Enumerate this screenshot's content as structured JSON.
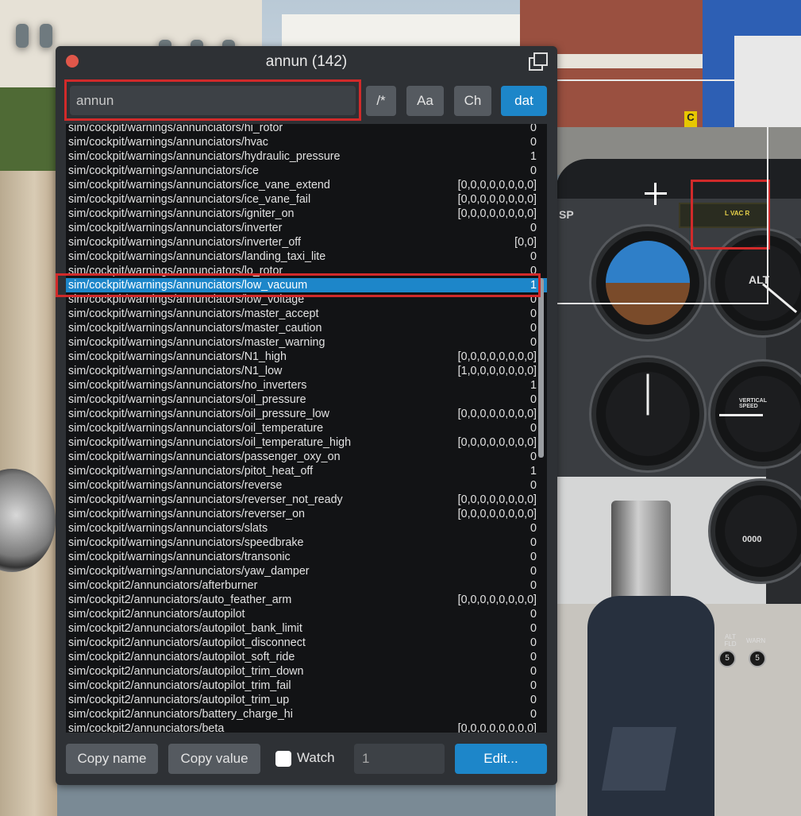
{
  "window": {
    "title": "annun (142)"
  },
  "search": {
    "value": "annun"
  },
  "toolbar": {
    "regex_label": "/*",
    "case_label": "Aa",
    "changes_label": "Ch",
    "dat_label": "dat"
  },
  "datarefs": [
    {
      "name": "sim/cockpit/warnings/annunciators/hi_rotor",
      "value": "0"
    },
    {
      "name": "sim/cockpit/warnings/annunciators/hvac",
      "value": "0"
    },
    {
      "name": "sim/cockpit/warnings/annunciators/hydraulic_pressure",
      "value": "1"
    },
    {
      "name": "sim/cockpit/warnings/annunciators/ice",
      "value": "0"
    },
    {
      "name": "sim/cockpit/warnings/annunciators/ice_vane_extend",
      "value": "[0,0,0,0,0,0,0,0]"
    },
    {
      "name": "sim/cockpit/warnings/annunciators/ice_vane_fail",
      "value": "[0,0,0,0,0,0,0,0]"
    },
    {
      "name": "sim/cockpit/warnings/annunciators/igniter_on",
      "value": "[0,0,0,0,0,0,0,0]"
    },
    {
      "name": "sim/cockpit/warnings/annunciators/inverter",
      "value": "0"
    },
    {
      "name": "sim/cockpit/warnings/annunciators/inverter_off",
      "value": "[0,0]"
    },
    {
      "name": "sim/cockpit/warnings/annunciators/landing_taxi_lite",
      "value": "0"
    },
    {
      "name": "sim/cockpit/warnings/annunciators/lo_rotor",
      "value": "0"
    },
    {
      "name": "sim/cockpit/warnings/annunciators/low_vacuum",
      "value": "1"
    },
    {
      "name": "sim/cockpit/warnings/annunciators/low_voltage",
      "value": "0"
    },
    {
      "name": "sim/cockpit/warnings/annunciators/master_accept",
      "value": "0"
    },
    {
      "name": "sim/cockpit/warnings/annunciators/master_caution",
      "value": "0"
    },
    {
      "name": "sim/cockpit/warnings/annunciators/master_warning",
      "value": "0"
    },
    {
      "name": "sim/cockpit/warnings/annunciators/N1_high",
      "value": "[0,0,0,0,0,0,0,0]"
    },
    {
      "name": "sim/cockpit/warnings/annunciators/N1_low",
      "value": "[1,0,0,0,0,0,0,0]"
    },
    {
      "name": "sim/cockpit/warnings/annunciators/no_inverters",
      "value": "1"
    },
    {
      "name": "sim/cockpit/warnings/annunciators/oil_pressure",
      "value": "0"
    },
    {
      "name": "sim/cockpit/warnings/annunciators/oil_pressure_low",
      "value": "[0,0,0,0,0,0,0,0]"
    },
    {
      "name": "sim/cockpit/warnings/annunciators/oil_temperature",
      "value": "0"
    },
    {
      "name": "sim/cockpit/warnings/annunciators/oil_temperature_high",
      "value": "[0,0,0,0,0,0,0,0]"
    },
    {
      "name": "sim/cockpit/warnings/annunciators/passenger_oxy_on",
      "value": "0"
    },
    {
      "name": "sim/cockpit/warnings/annunciators/pitot_heat_off",
      "value": "1"
    },
    {
      "name": "sim/cockpit/warnings/annunciators/reverse",
      "value": "0"
    },
    {
      "name": "sim/cockpit/warnings/annunciators/reverser_not_ready",
      "value": "[0,0,0,0,0,0,0,0]"
    },
    {
      "name": "sim/cockpit/warnings/annunciators/reverser_on",
      "value": "[0,0,0,0,0,0,0,0]"
    },
    {
      "name": "sim/cockpit/warnings/annunciators/slats",
      "value": "0"
    },
    {
      "name": "sim/cockpit/warnings/annunciators/speedbrake",
      "value": "0"
    },
    {
      "name": "sim/cockpit/warnings/annunciators/transonic",
      "value": "0"
    },
    {
      "name": "sim/cockpit/warnings/annunciators/yaw_damper",
      "value": "0"
    },
    {
      "name": "sim/cockpit2/annunciators/afterburner",
      "value": "0"
    },
    {
      "name": "sim/cockpit2/annunciators/auto_feather_arm",
      "value": "[0,0,0,0,0,0,0,0]"
    },
    {
      "name": "sim/cockpit2/annunciators/autopilot",
      "value": "0"
    },
    {
      "name": "sim/cockpit2/annunciators/autopilot_bank_limit",
      "value": "0"
    },
    {
      "name": "sim/cockpit2/annunciators/autopilot_disconnect",
      "value": "0"
    },
    {
      "name": "sim/cockpit2/annunciators/autopilot_soft_ride",
      "value": "0"
    },
    {
      "name": "sim/cockpit2/annunciators/autopilot_trim_down",
      "value": "0"
    },
    {
      "name": "sim/cockpit2/annunciators/autopilot_trim_fail",
      "value": "0"
    },
    {
      "name": "sim/cockpit2/annunciators/autopilot_trim_up",
      "value": "0"
    },
    {
      "name": "sim/cockpit2/annunciators/battery_charge_hi",
      "value": "0"
    },
    {
      "name": "sim/cockpit2/annunciators/beta",
      "value": "[0,0,0,0,0,0,0,0]"
    }
  ],
  "selected_index": 11,
  "footer": {
    "copy_name_label": "Copy name",
    "copy_value_label": "Copy value",
    "watch_label": "Watch",
    "value_field": "1",
    "edit_label": "Edit..."
  },
  "cockpit": {
    "annunciator_label": "L VAC R",
    "gauge_alt_label": "ALT",
    "gauge_vsi_label": "VERTICAL SPEED",
    "gauge_tach_label": "0000",
    "panel_labels": [
      "SP",
      "C",
      "ALT FLD",
      "WARN"
    ]
  }
}
